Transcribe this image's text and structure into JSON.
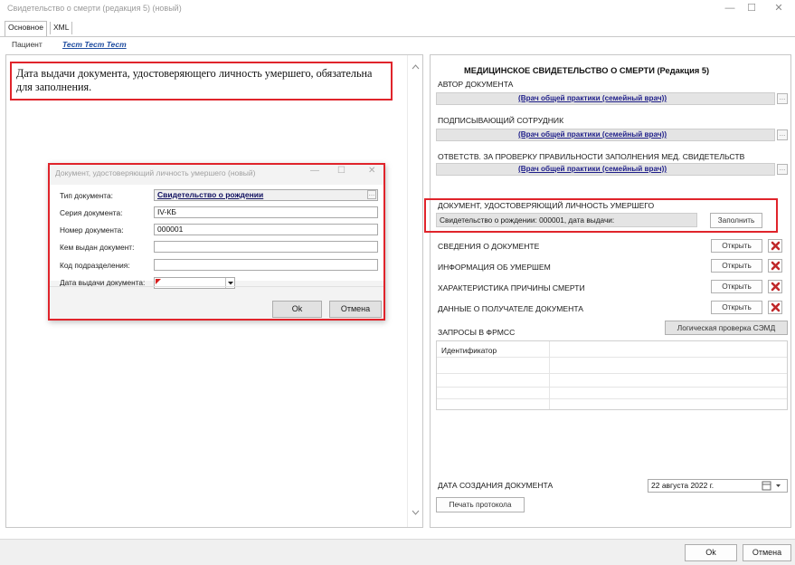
{
  "window": {
    "title": "Свидетельство о смерти (редакция 5) (новый)",
    "min_icon": "—",
    "max_icon": "☐",
    "close_icon": "✕"
  },
  "tabs": [
    {
      "label": "Основное"
    },
    {
      "label": "XML"
    }
  ],
  "patient": {
    "label": "Пациент",
    "name": "Тест Тест Тест"
  },
  "message": "Дата выдачи документа, удостоверяющего личность умершего, обязательна для заполнения.",
  "dialog": {
    "title": "Документ, удостоверяющий личность умершего (новый)",
    "fields": [
      {
        "label": "Тип документа:",
        "value": "Свидетельство о рождении"
      },
      {
        "label": "Серия документа:",
        "value": "IV-КБ"
      },
      {
        "label": "Номер документа:",
        "value": "000001"
      },
      {
        "label": "Кем выдан документ:",
        "value": ""
      },
      {
        "label": "Код подразделения:",
        "value": ""
      },
      {
        "label": "Дата выдачи документа:",
        "value": ""
      }
    ],
    "ok_label": "Ok",
    "cancel_label": "Отмена"
  },
  "right": {
    "heading": "МЕДИЦИНСКОЕ СВИДЕТЕЛЬСТВО О СМЕРТИ (Редакция 5)",
    "author_label": "АВТОР ДОКУМЕНТА",
    "author_role": "(Врач общей практики (семейный врач))",
    "signer_label": "ПОДПИСЫВАЮЩИЙ СОТРУДНИК",
    "signer_role": "(Врач общей практики (семейный врач))",
    "resp_label": "ОТВЕТСТВ. ЗА ПРОВЕРКУ ПРАВИЛЬНОСТИ ЗАПОЛНЕНИЯ МЕД. СВИДЕТЕЛЬСТВ",
    "resp_role": "(Врач общей практики (семейный врач))",
    "id_doc_label": "ДОКУМЕНТ, УДОСТОВЕРЯЮЩИЙ ЛИЧНОСТЬ УМЕРШЕГО",
    "id_doc_value": "Свидетельство о рождении: 000001, дата выдачи:",
    "fill_button": "Заполнить",
    "sections": [
      {
        "label": "СВЕДЕНИЯ О ДОКУМЕНТЕ",
        "button": "Открыть"
      },
      {
        "label": "ИНФОРМАЦИЯ ОБ УМЕРШЕМ",
        "button": "Открыть"
      },
      {
        "label": "ХАРАКТЕРИСТИКА ПРИЧИНЫ СМЕРТИ",
        "button": "Открыть"
      },
      {
        "label": "ДАННЫЕ О ПОЛУЧАТЕЛЕ ДОКУМЕНТА",
        "button": "Открыть"
      }
    ],
    "requests_label": "ЗАПРОСЫ В ФРМСС",
    "logic_check_button": "Логическая проверка СЭМД",
    "grid_header": "Идентификатор",
    "created_label": "ДАТА СОЗДАНИЯ ДОКУМЕНТА",
    "created_value": "22  августа  2022 г.",
    "print_button": "Печать протокола"
  },
  "footer": {
    "ok_label": "Ok",
    "cancel_label": "Отмена"
  }
}
